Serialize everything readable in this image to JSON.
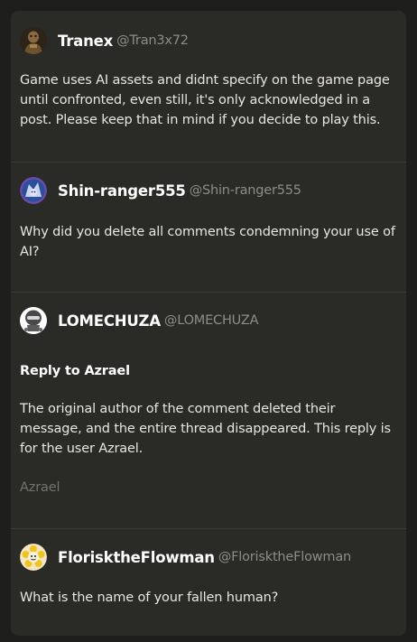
{
  "comments": [
    {
      "name": "Tranex",
      "handle": "@Tran3x72",
      "avatar_icon": "brown-figure-avatar",
      "text": "Game uses AI assets and didnt specify on the game page until confronted, even still, it's only acknowledged in a post. Please keep that in mind if you decide to play this."
    },
    {
      "name": "Shin-ranger555",
      "handle": "@Shin-ranger555",
      "avatar_icon": "purple-character-avatar",
      "text": "Why did you delete all comments condemning your use of AI?"
    },
    {
      "name": "LOMECHUZA",
      "handle": "@LOMECHUZA",
      "avatar_icon": "robot-helmet-avatar",
      "reply_label": "Reply to Azrael",
      "text": "The original author of the comment deleted their message, and the entire thread disappeared. This reply is for the user Azrael.",
      "mention": "Azrael"
    },
    {
      "name": "FlorisktheFlowman",
      "handle": "@FlorisktheFlowman",
      "avatar_icon": "flower-character-avatar",
      "text": "What is the name of your fallen human?"
    }
  ],
  "colors": {
    "page_background": "#1e1e1c",
    "panel_background": "#2a2a27",
    "separator": "#3a3a36",
    "username": "#ffffff",
    "handle": "#8e8c86",
    "body_text": "#e8e6e1",
    "mention": "#75736d"
  }
}
